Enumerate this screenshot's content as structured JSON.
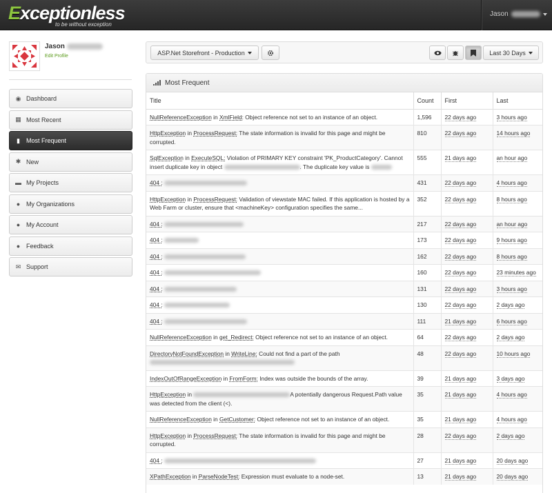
{
  "app": {
    "logo_main": "Exceptionless",
    "logo_tagline": "to be without exception"
  },
  "user": {
    "name": "Jason",
    "edit_profile": "Edit Profile"
  },
  "sidebar": {
    "items": [
      {
        "label": "Dashboard",
        "icon": "dashboard-icon",
        "active": false
      },
      {
        "label": "Most Recent",
        "icon": "calendar-icon",
        "active": false
      },
      {
        "label": "Most Frequent",
        "icon": "signal-icon",
        "active": true
      },
      {
        "label": "New",
        "icon": "asterisk-icon",
        "active": false
      },
      {
        "label": "My Projects",
        "icon": "briefcase-icon",
        "active": false
      },
      {
        "label": "My Organizations",
        "icon": "users-icon",
        "active": false
      },
      {
        "label": "My Account",
        "icon": "user-icon",
        "active": false
      },
      {
        "label": "Feedback",
        "icon": "comment-icon",
        "active": false
      },
      {
        "label": "Support",
        "icon": "envelope-icon",
        "active": false
      }
    ]
  },
  "toolbar": {
    "project": "ASP.Net Storefront - Production",
    "date_range": "Last 30 Days"
  },
  "panel": {
    "title": "Most Frequent",
    "columns": [
      "Title",
      "Count",
      "First",
      "Last"
    ]
  },
  "rows": [
    {
      "exception": "NullReferenceException",
      "in": " in ",
      "method": "XmlField:",
      "message": " Object reference not set to an instance of an object.",
      "count": "1,596",
      "first": "22 days ago",
      "last": "3 hours ago",
      "blur": 0
    },
    {
      "exception": "HttpException",
      "in": " in ",
      "method": "ProcessRequest:",
      "message": " The state information is invalid for this page and might be corrupted.",
      "count": "810",
      "first": "22 days ago",
      "last": "14 hours ago",
      "blur": 0
    },
    {
      "exception": "SqlException",
      "in": " in ",
      "method": "ExecuteSQL:",
      "message": " Violation of PRIMARY KEY constraint 'PK_ProductCategory'. Cannot insert duplicate key in object ",
      "message2": ". The duplicate key value is ",
      "count": "555",
      "first": "21 days ago",
      "last": "an hour ago",
      "blur": 0
    },
    {
      "exception": "404 :",
      "count": "431",
      "first": "22 days ago",
      "last": "4 hours ago",
      "blur": 120
    },
    {
      "exception": "HttpException",
      "in": " in ",
      "method": "ProcessRequest:",
      "message": " Validation of viewstate MAC failed. If this application is hosted by a Web Farm or cluster, ensure that <machineKey> configuration specifies the same...",
      "count": "352",
      "first": "22 days ago",
      "last": "8 hours ago",
      "blur": 0
    },
    {
      "exception": "404 :",
      "count": "217",
      "first": "22 days ago",
      "last": "an hour ago",
      "blur": 115
    },
    {
      "exception": "404 :",
      "count": "173",
      "first": "22 days ago",
      "last": "9 hours ago",
      "blur": 50
    },
    {
      "exception": "404 :",
      "count": "162",
      "first": "22 days ago",
      "last": "8 hours ago",
      "blur": 118
    },
    {
      "exception": "404 :",
      "count": "160",
      "first": "22 days ago",
      "last": "23 minutes ago",
      "blur": 140
    },
    {
      "exception": "404 :",
      "count": "131",
      "first": "22 days ago",
      "last": "3 hours ago",
      "blur": 105
    },
    {
      "exception": "404 :",
      "count": "130",
      "first": "22 days ago",
      "last": "2 days ago",
      "blur": 95
    },
    {
      "exception": "404 :",
      "count": "111",
      "first": "21 days ago",
      "last": "6 hours ago",
      "blur": 120
    },
    {
      "exception": "NullReferenceException",
      "in": " in ",
      "method": "get_Redirect:",
      "message": " Object reference not set to an instance of an object.",
      "count": "64",
      "first": "22 days ago",
      "last": "2 days ago",
      "blur": 0
    },
    {
      "exception": "DirectoryNotFoundException",
      "in": " in ",
      "method": "WriteLine:",
      "message": " Could not find a part of the path",
      "count": "48",
      "first": "22 days ago",
      "last": "10 hours ago",
      "blur": 0,
      "line2blur": 210
    },
    {
      "exception": "IndexOutOfRangeException",
      "in": " in ",
      "method": "FromForm:",
      "message": " Index was outside the bounds of the array.",
      "count": "39",
      "first": "21 days ago",
      "last": "3 days ago",
      "blur": 0
    },
    {
      "exception": "HttpException",
      "in": " in ",
      "method": "",
      "message": "A potentially dangerous Request.Path value was detected from the client (<).",
      "count": "35",
      "first": "21 days ago",
      "last": "4 hours ago",
      "blur": 0,
      "inlineblur": 140
    },
    {
      "exception": "NullReferenceException",
      "in": " in ",
      "method": "GetCustomer:",
      "message": " Object reference not set to an instance of an object.",
      "count": "35",
      "first": "21 days ago",
      "last": "4 hours ago",
      "blur": 0
    },
    {
      "exception": "HttpException",
      "in": " in ",
      "method": "ProcessRequest:",
      "message": " The state information is invalid for this page and might be corrupted.",
      "count": "28",
      "first": "22 days ago",
      "last": "2 days ago",
      "blur": 0
    },
    {
      "exception": "404 :",
      "count": "27",
      "first": "21 days ago",
      "last": "20 days ago",
      "blur": 220
    },
    {
      "exception": "XPathException",
      "in": " in ",
      "method": "ParseNodeTest:",
      "message": " Expression must evaluate to a node-set.",
      "count": "13",
      "first": "21 days ago",
      "last": "20 days ago",
      "blur": 0
    }
  ]
}
